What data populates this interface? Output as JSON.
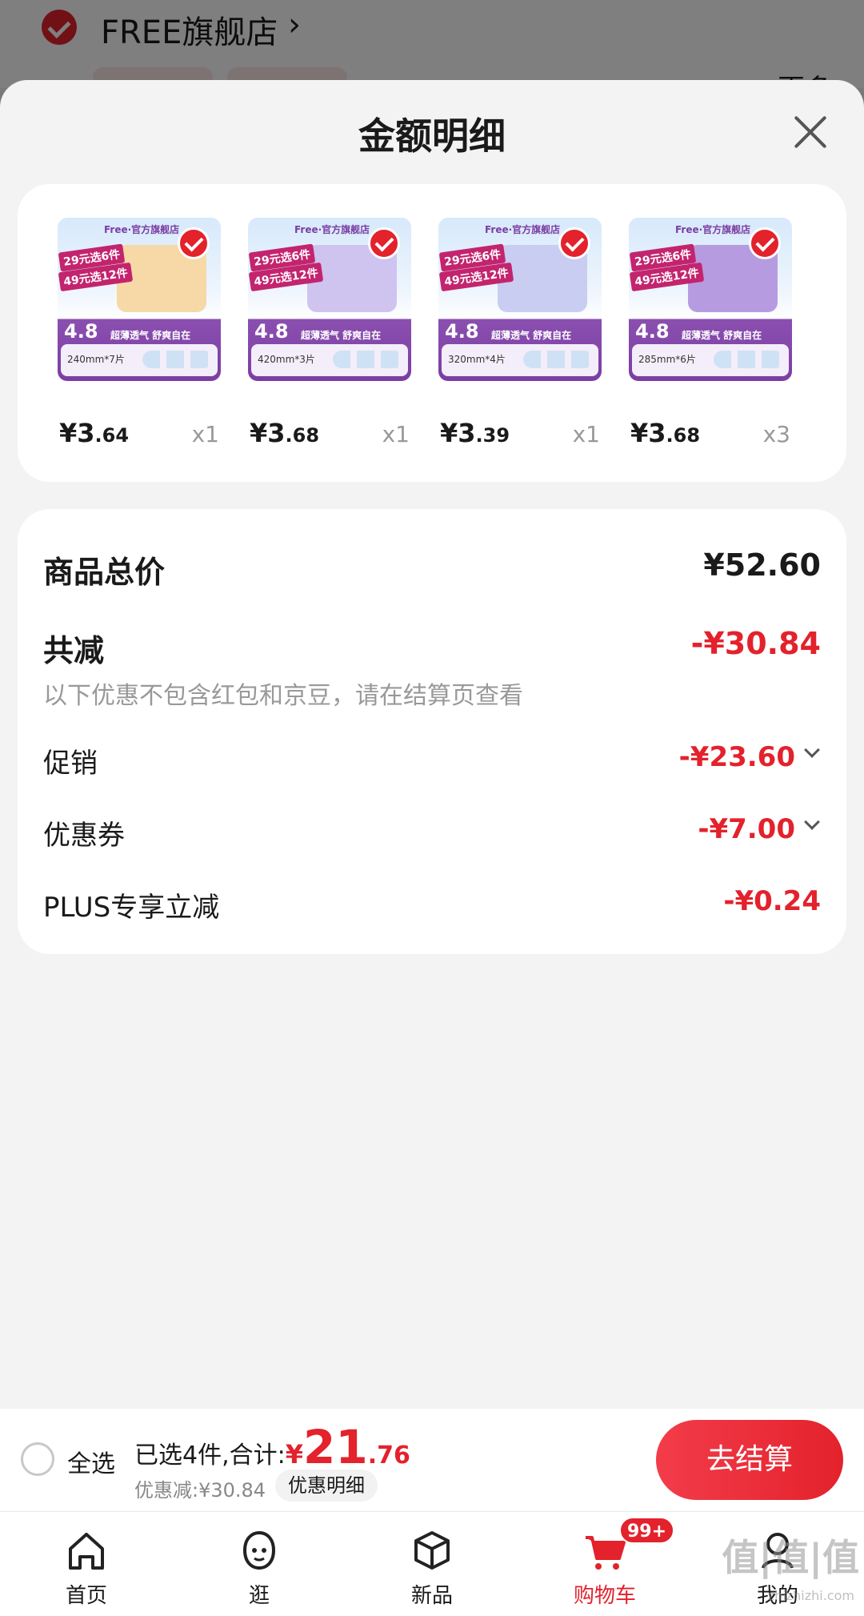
{
  "background": {
    "store_name": "FREE旗舰店",
    "chevron": "›",
    "more_label": "更多"
  },
  "sheet": {
    "title": "金额明细",
    "close_icon": "close-icon"
  },
  "products": [
    {
      "size": "240mm*7片",
      "price_int": "¥3",
      "price_dec": ".64",
      "qty": "x1",
      "promo1": "29元选6件",
      "promo2": "49元选12件",
      "rating": "4.8",
      "slogan": "超薄透气 舒爽自在",
      "brand": "Free·官方旗舰店",
      "pack_color": "#f6d9a6"
    },
    {
      "size": "420mm*3片",
      "price_int": "¥3",
      "price_dec": ".68",
      "qty": "x1",
      "promo1": "29元选6件",
      "promo2": "49元选12件",
      "rating": "4.8",
      "slogan": "超薄透气 舒爽自在",
      "brand": "Free·官方旗舰店",
      "pack_color": "#cfc3f0"
    },
    {
      "size": "320mm*4片",
      "price_int": "¥3",
      "price_dec": ".39",
      "qty": "x1",
      "promo1": "29元选6件",
      "promo2": "49元选12件",
      "rating": "4.8",
      "slogan": "超薄透气 舒爽自在",
      "brand": "Free·官方旗舰店",
      "pack_color": "#c9cdf2"
    },
    {
      "size": "285mm*6片",
      "price_int": "¥3",
      "price_dec": ".68",
      "qty": "x3",
      "promo1": "29元选6件",
      "promo2": "49元选12件",
      "rating": "4.8",
      "slogan": "超薄透气 舒爽自在",
      "brand": "Free·官方旗舰店",
      "pack_color": "#b79be0"
    }
  ],
  "summary": {
    "total_label": "商品总价",
    "total_value": "¥52.60",
    "reduce_label": "共减",
    "reduce_value": "-¥30.84",
    "note": "以下优惠不包含红包和京豆，请在结算页查看",
    "promo_label": "促销",
    "promo_value": "-¥23.60",
    "coupon_label": "优惠券",
    "coupon_value": "-¥7.00",
    "plus_label": "PLUS专享立减",
    "plus_value": "-¥0.24"
  },
  "checkout": {
    "select_all": "全选",
    "selected_text": "已选4件,合计:",
    "currency": "¥",
    "total_int": "21",
    "total_dec": ".76",
    "discount_text": "优惠减:¥30.84",
    "detail_label": "优惠明细",
    "button_label": "去结算"
  },
  "tabs": [
    {
      "label": "首页",
      "icon": "home-icon"
    },
    {
      "label": "逛",
      "icon": "explore-face-icon"
    },
    {
      "label": "新品",
      "icon": "box-icon"
    },
    {
      "label": "购物车",
      "icon": "cart-icon",
      "badge": "99+",
      "active": true
    },
    {
      "label": "我的",
      "icon": "user-icon"
    }
  ],
  "colors": {
    "accent": "#e3222c",
    "muted": "#999999"
  },
  "watermark": {
    "main": "值|值|值",
    "sub": "zhizhizhi.com"
  }
}
